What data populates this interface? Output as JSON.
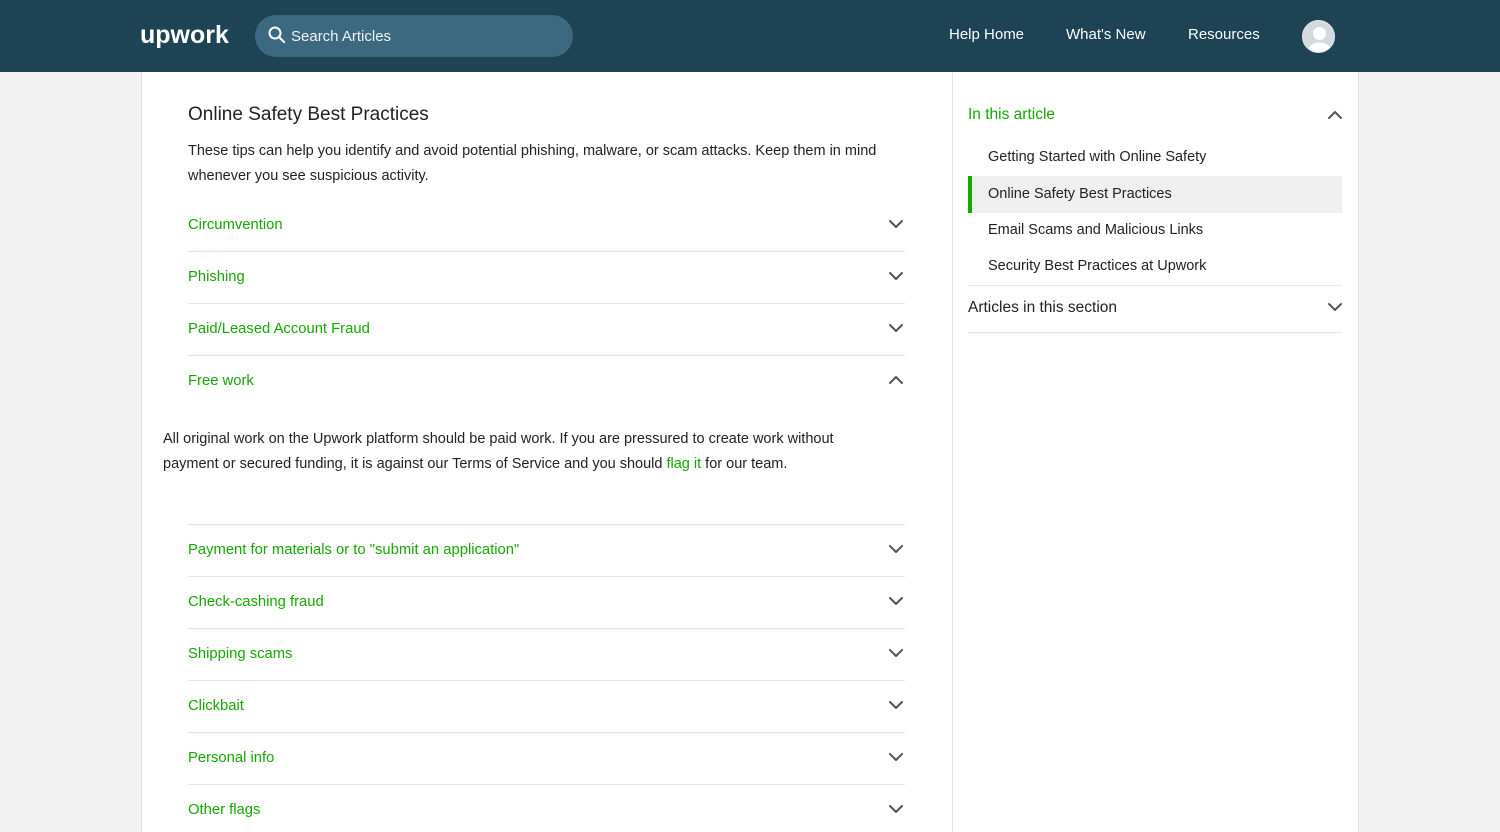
{
  "header": {
    "logo_text": "upwork",
    "search_placeholder": "Search Articles",
    "nav": [
      "Help Home",
      "What's New",
      "Resources"
    ]
  },
  "article": {
    "title": "Online Safety Best Practices",
    "intro": "These tips can help you identify and avoid potential phishing, malware, or scam attacks. Keep them in mind whenever you see suspicious activity.",
    "accordion": [
      {
        "title": "Circumvention",
        "expanded": false
      },
      {
        "title": "Phishing",
        "expanded": false
      },
      {
        "title": "Paid/Leased Account Fraud",
        "expanded": false
      },
      {
        "title": "Free work",
        "expanded": true
      },
      {
        "title": "Payment for materials or to \"submit an application\"",
        "expanded": false
      },
      {
        "title": "Check-cashing fraud",
        "expanded": false
      },
      {
        "title": "Shipping scams",
        "expanded": false
      },
      {
        "title": "Clickbait",
        "expanded": false
      },
      {
        "title": "Personal info",
        "expanded": false
      },
      {
        "title": "Other flags",
        "expanded": false
      }
    ],
    "expanded_body": {
      "before_link": "All original work on the Upwork platform should be paid work. If you are pressured to create work without payment or secured funding, it is against our Terms of Service and you should ",
      "link_text": "flag it",
      "after_link": " for our team."
    }
  },
  "sidebar": {
    "in_this_article_title": "In this article",
    "items": [
      "Getting Started with Online Safety",
      "Online Safety Best Practices",
      "Email Scams and Malicious Links",
      "Security Best Practices at Upwork"
    ],
    "active_index": 1,
    "section_title": "Articles in this section"
  },
  "colors": {
    "header_bg": "#1d4354",
    "search_bg": "#3c6880",
    "accent_green": "#14a800",
    "page_bg": "#f2f2f2"
  }
}
